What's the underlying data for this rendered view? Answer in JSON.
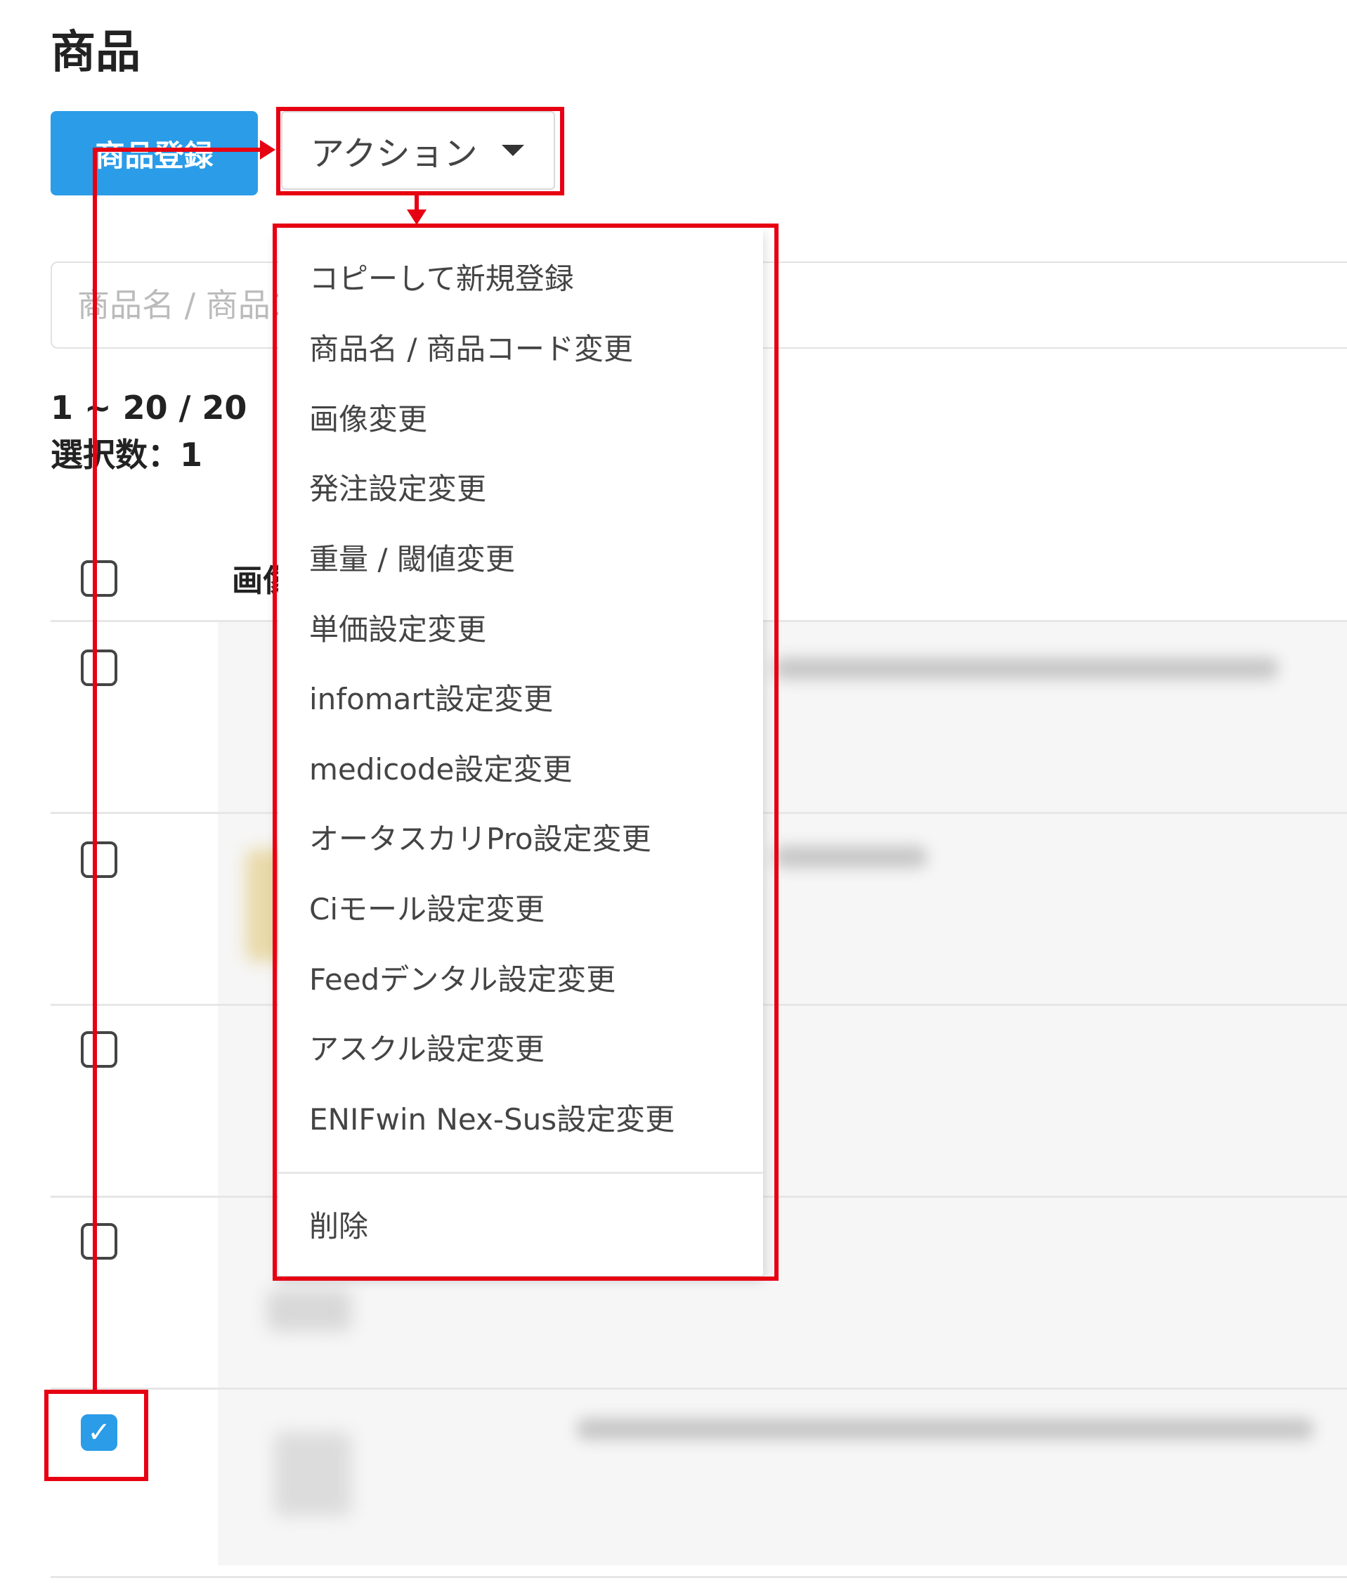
{
  "page": {
    "title": "商品"
  },
  "toolbar": {
    "register_label": "商品登録",
    "action_label": "アクション"
  },
  "search": {
    "placeholder": "商品名 / 商品コード"
  },
  "results": {
    "count": "1 ~ 20 / 20",
    "selected": "選択数：1"
  },
  "table": {
    "header_image": "画像"
  },
  "action_menu": {
    "items": [
      "コピーして新規登録",
      "商品名 / 商品コード変更",
      "画像変更",
      "発注設定変更",
      "重量 / 閾値変更",
      "単価設定変更",
      "infomart設定変更",
      "medicode設定変更",
      "オータスカリPro設定変更",
      "Ciモール設定変更",
      "Feedデンタル設定変更",
      "アスクル設定変更",
      "ENIFwin Nex-Sus設定変更"
    ],
    "delete_label": "削除"
  },
  "colors": {
    "accent": "#2b9ce8",
    "annotation": "#e60012"
  },
  "rows": [
    {
      "checked": false
    },
    {
      "checked": false
    },
    {
      "checked": false
    },
    {
      "checked": false
    },
    {
      "checked": true
    }
  ]
}
